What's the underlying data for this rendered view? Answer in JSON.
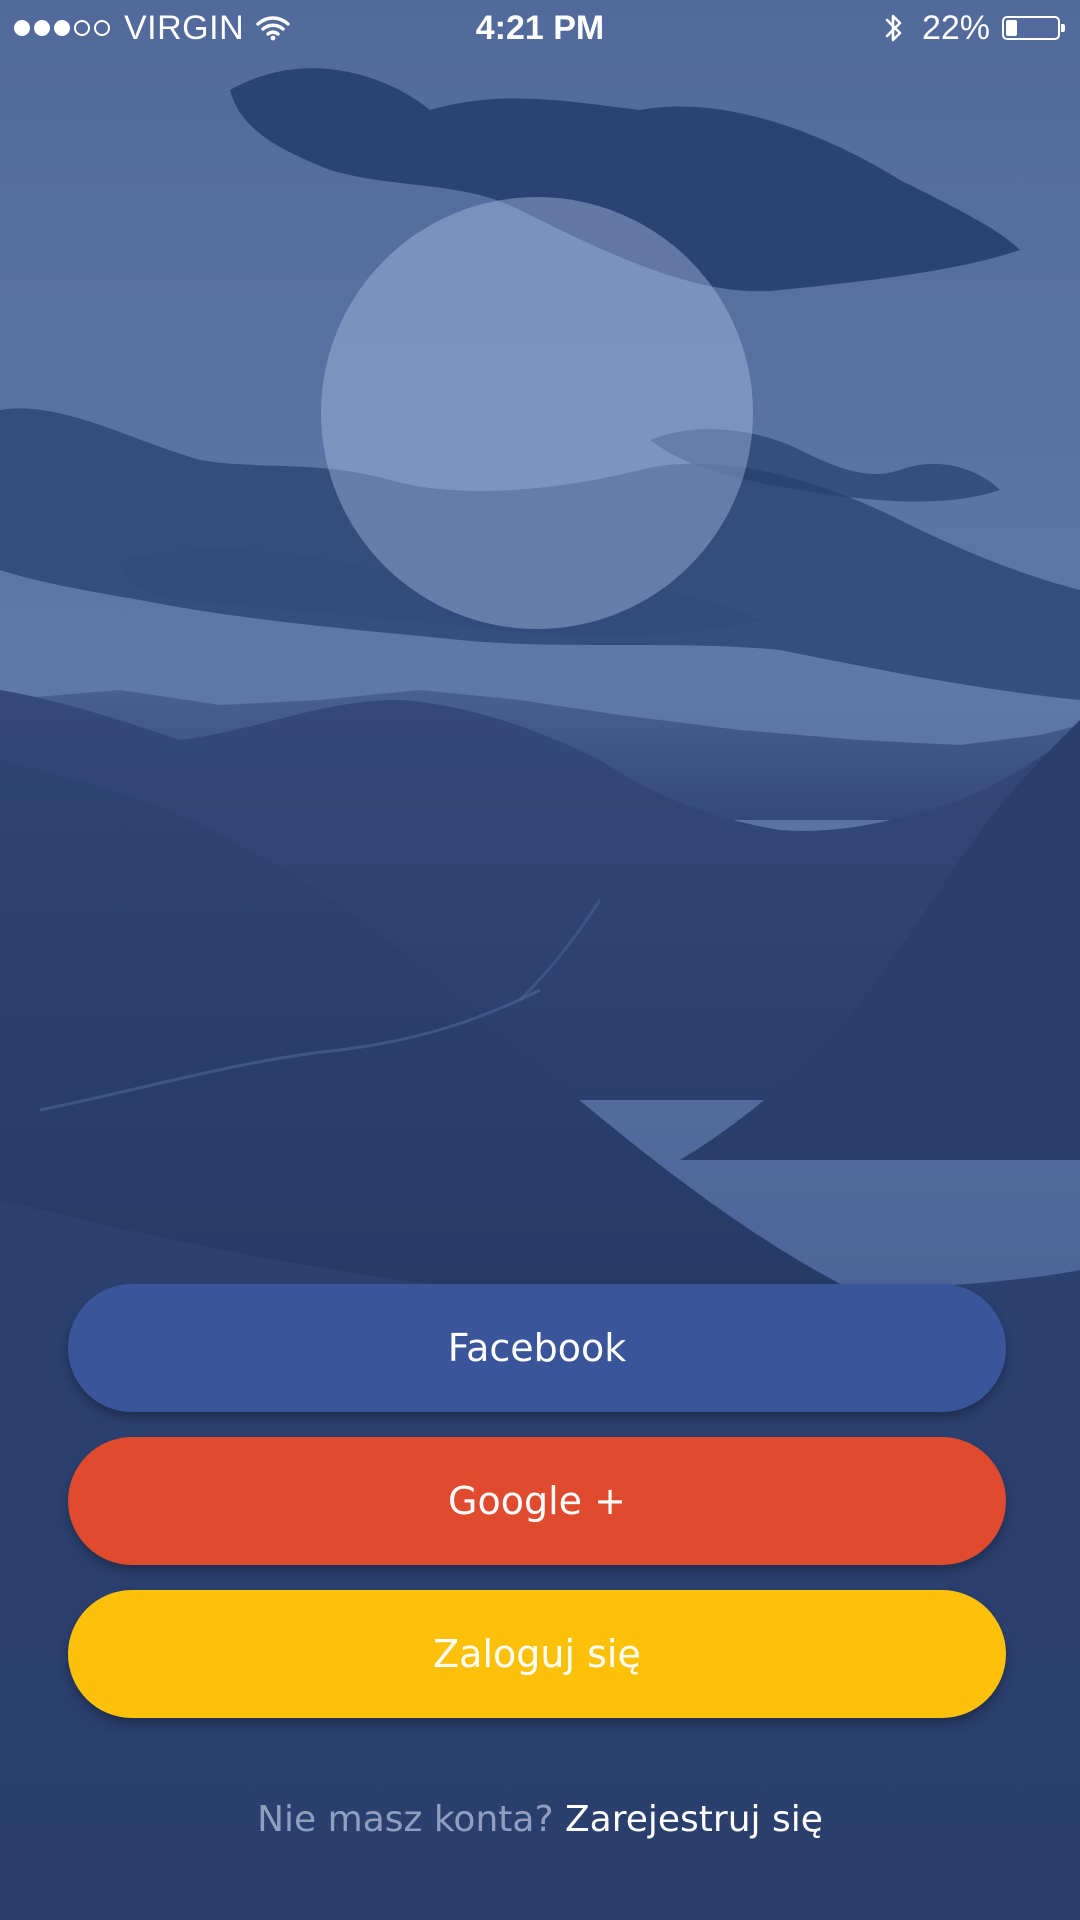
{
  "status_bar": {
    "signal_filled": 3,
    "signal_total": 5,
    "carrier": "VIRGIN",
    "time": "4:21 PM",
    "battery_percent_text": "22%",
    "battery_level": 0.22
  },
  "buttons": {
    "facebook_label": "Facebook",
    "google_label": "Google +",
    "login_label": "Zaloguj się"
  },
  "footer": {
    "question": "Nie masz konta?",
    "register_link": "Zarejestruj się"
  },
  "colors": {
    "facebook": "#3a5599",
    "google": "#e04a2f",
    "login": "#fdc10a",
    "overlay": "#2e4a85"
  },
  "icons": {
    "wifi": "wifi-icon",
    "bluetooth": "bluetooth-icon",
    "battery": "battery-icon"
  }
}
